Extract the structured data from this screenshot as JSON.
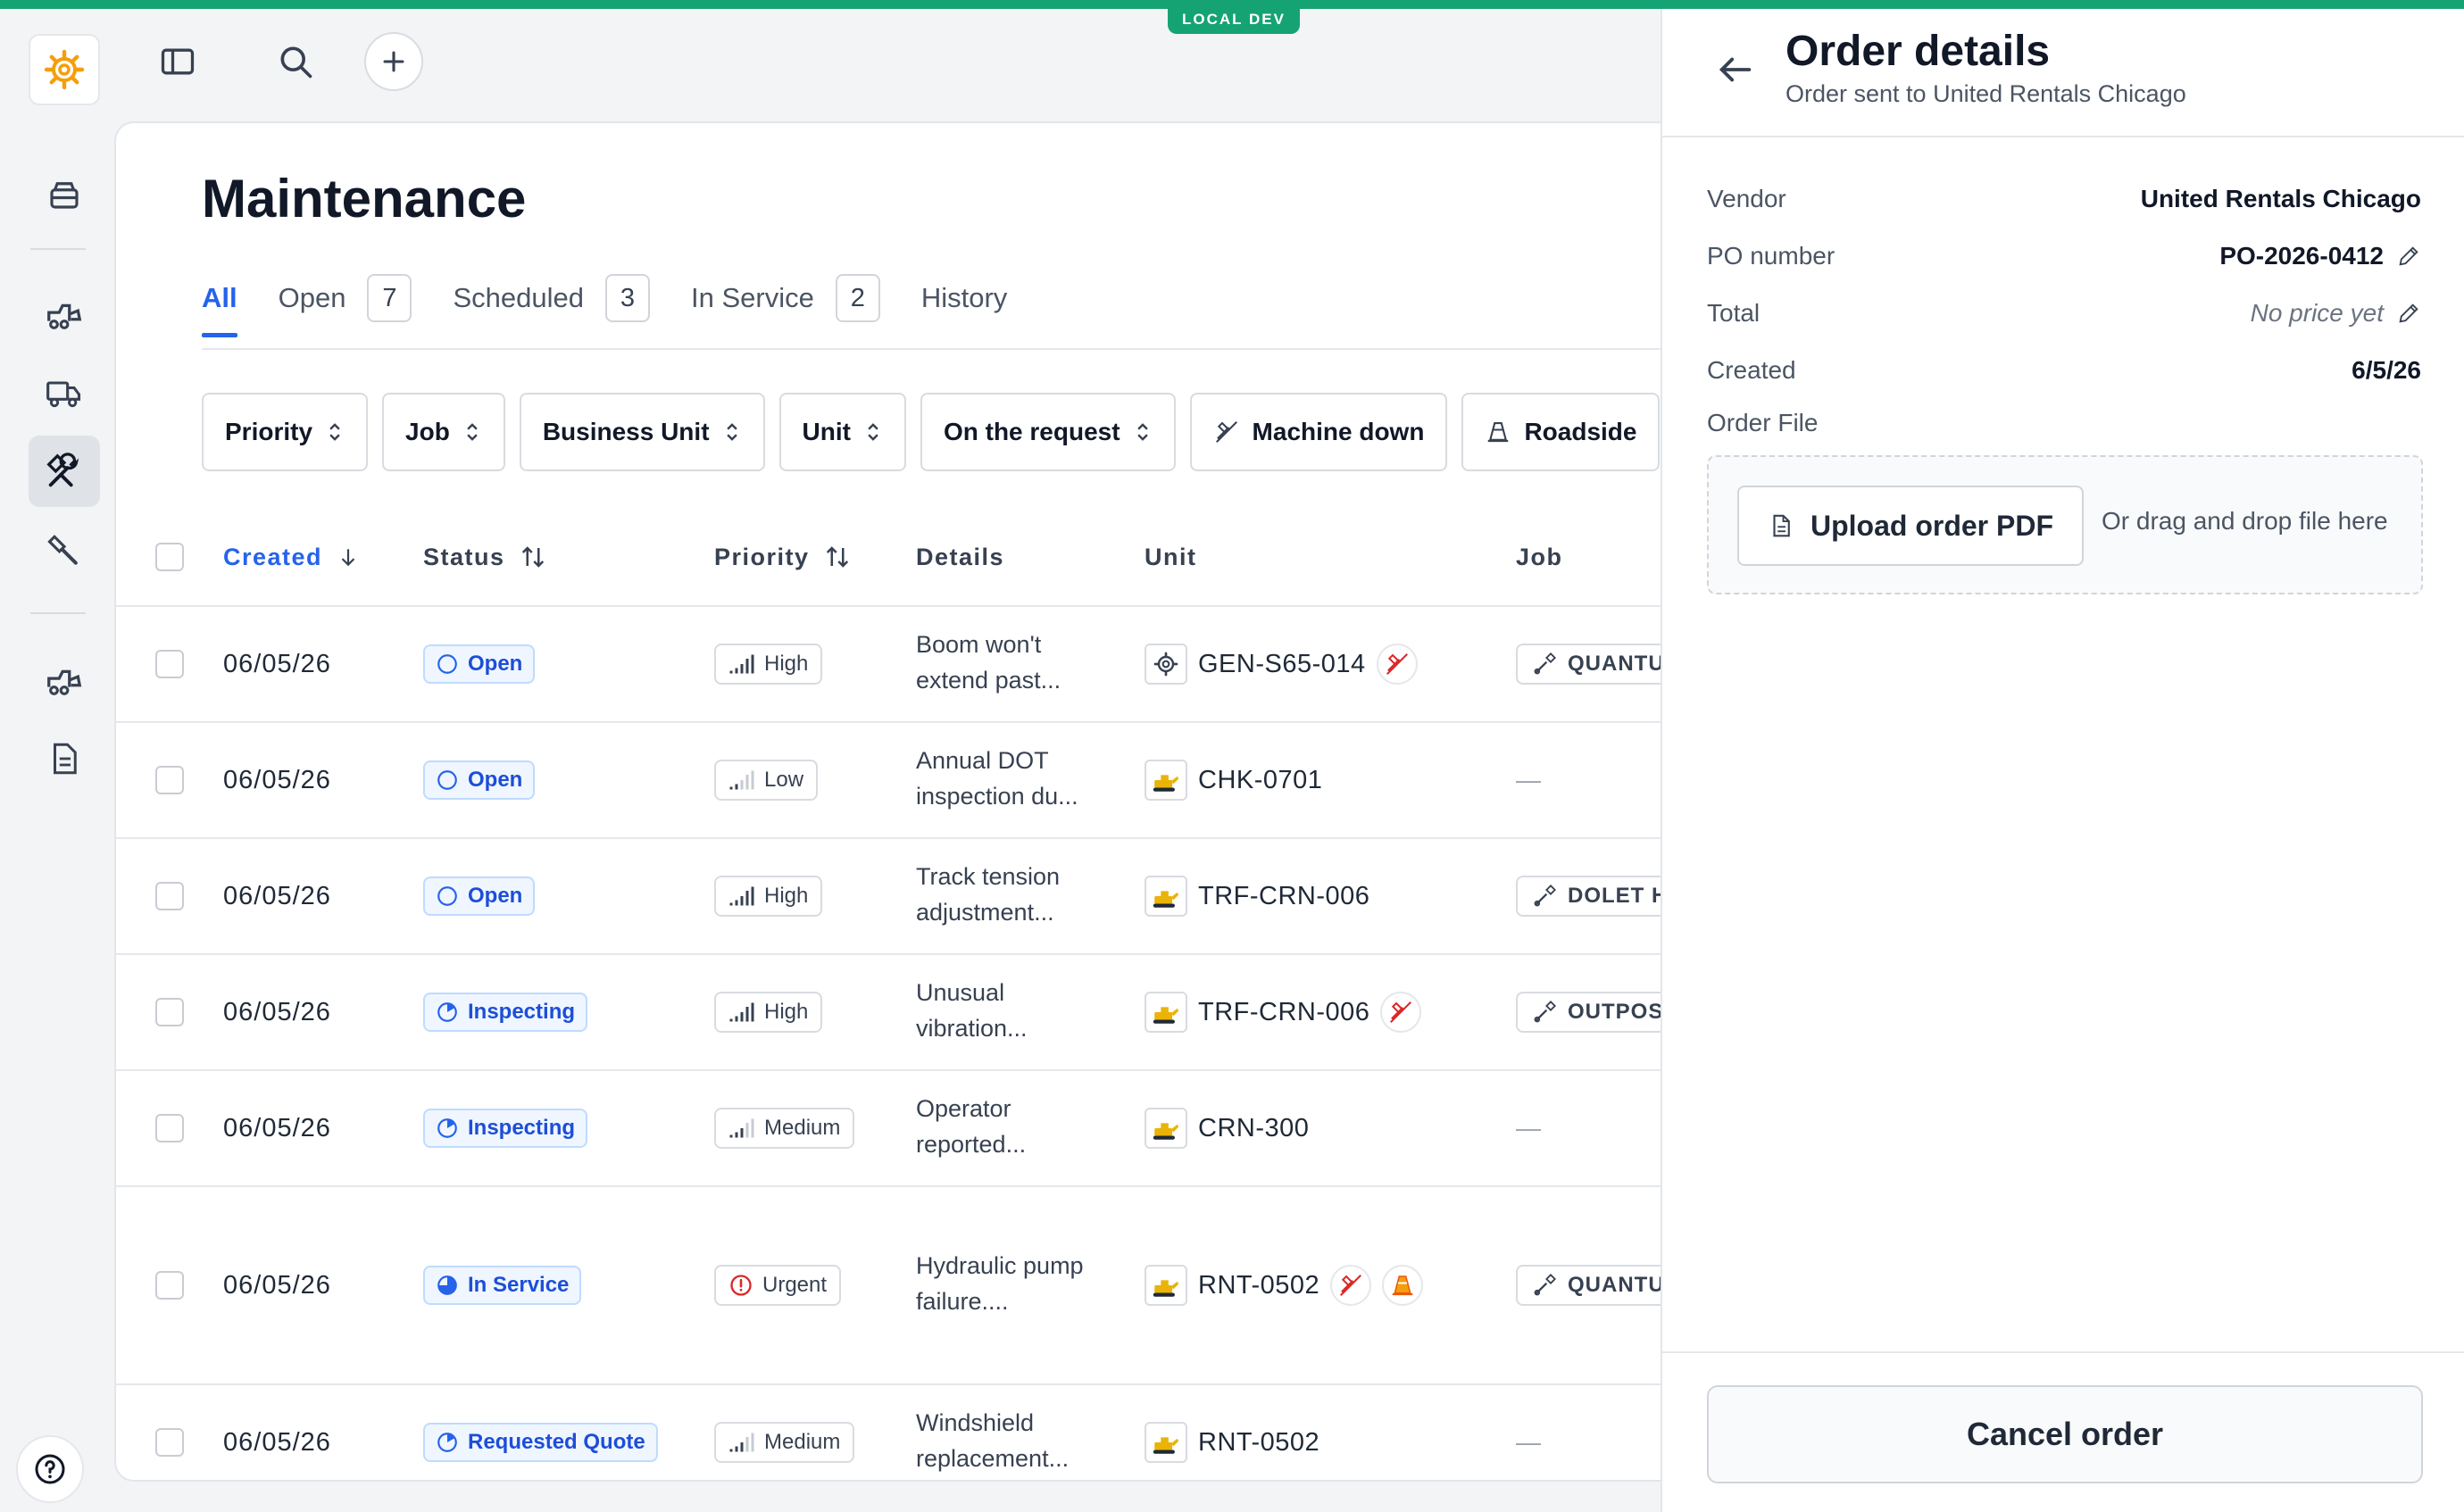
{
  "env_badge": "LOCAL DEV",
  "page": {
    "title": "Maintenance"
  },
  "tabs": [
    {
      "label": "All",
      "count": null
    },
    {
      "label": "Open",
      "count": "7"
    },
    {
      "label": "Scheduled",
      "count": "3"
    },
    {
      "label": "In Service",
      "count": "2"
    },
    {
      "label": "History",
      "count": null
    }
  ],
  "filters": [
    "Priority",
    "Job",
    "Business Unit",
    "Unit",
    "On the request",
    "Machine down",
    "Roadside"
  ],
  "columns": {
    "created": "Created",
    "status": "Status",
    "priority": "Priority",
    "details": "Details",
    "unit": "Unit",
    "job": "Job"
  },
  "rows": [
    {
      "created": "06/05/26",
      "status": "Open",
      "priority": "High",
      "details": "Boom won't extend past...",
      "unit": "GEN-S65-014",
      "job": "QUANTUM"
    },
    {
      "created": "06/05/26",
      "status": "Open",
      "priority": "Low",
      "details": "Annual DOT inspection du...",
      "unit": "CHK-0701",
      "job": "—"
    },
    {
      "created": "06/05/26",
      "status": "Open",
      "priority": "High",
      "details": "Track tension adjustment...",
      "unit": "TRF-CRN-006",
      "job": "DOLET HI"
    },
    {
      "created": "06/05/26",
      "status": "Inspecting",
      "priority": "High",
      "details": "Unusual vibration...",
      "unit": "TRF-CRN-006",
      "job": "OUTPOST"
    },
    {
      "created": "06/05/26",
      "status": "Inspecting",
      "priority": "Medium",
      "details": "Operator reported...",
      "unit": "CRN-300",
      "job": "—"
    },
    {
      "created": "06/05/26",
      "status": "In Service",
      "priority": "Urgent",
      "details": "Hydraulic pump failure....",
      "unit": "RNT-0502",
      "job": "QUANTUM"
    },
    {
      "created": "06/05/26",
      "status": "Requested Quote",
      "priority": "Medium",
      "details": "Windshield replacement...",
      "unit": "RNT-0502",
      "job": "—"
    }
  ],
  "drawer": {
    "title": "Order details",
    "subtitle": "Order sent to United Rentals Chicago",
    "vendor_label": "Vendor",
    "vendor_value": "United Rentals Chicago",
    "po_label": "PO number",
    "po_value": "PO-2026-0412",
    "total_label": "Total",
    "total_value": "No price yet",
    "created_label": "Created",
    "created_value": "6/5/26",
    "order_file_label": "Order File",
    "upload_label": "Upload order PDF",
    "drop_hint": "Or drag and drop file here",
    "cancel_label": "Cancel order"
  },
  "colors": {
    "accent": "#16a374",
    "link": "#2563eb",
    "danger": "#dc2626",
    "warning": "#f59e0b"
  }
}
